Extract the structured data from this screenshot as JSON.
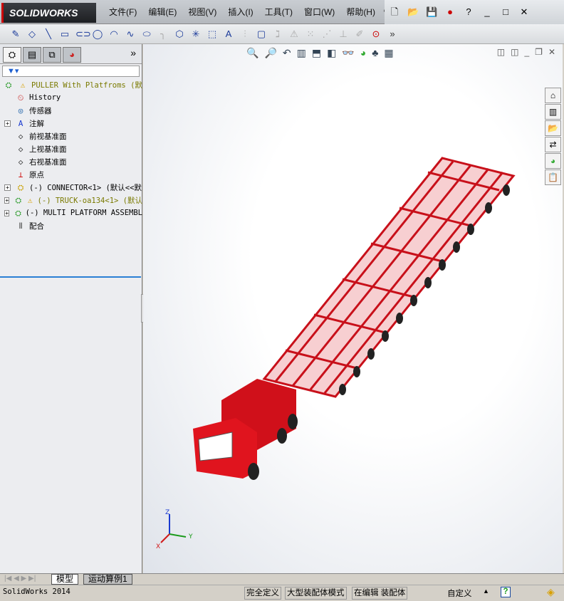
{
  "app": {
    "logo": "SOLIDWORKS"
  },
  "menu": [
    "文件(F)",
    "编辑(E)",
    "视图(V)",
    "插入(I)",
    "工具(T)",
    "窗口(W)",
    "帮助(H)"
  ],
  "panel": {
    "tree": [
      {
        "label": "PULLER With Platfroms  (默",
        "icon": "assembly",
        "warn": true,
        "olive": true,
        "expand": false,
        "top": true
      },
      {
        "label": "History",
        "icon": "history"
      },
      {
        "label": "传感器",
        "icon": "sensor"
      },
      {
        "label": "注解",
        "icon": "annotation",
        "expand": true
      },
      {
        "label": "前视基准面",
        "icon": "plane"
      },
      {
        "label": "上视基准面",
        "icon": "plane"
      },
      {
        "label": "右视基准面",
        "icon": "plane"
      },
      {
        "label": "原点",
        "icon": "origin"
      },
      {
        "label": "(-) CONNECTOR<1> (默认<<默",
        "icon": "part",
        "expand": true
      },
      {
        "label": "(-) TRUCK-oa134<1> (默认",
        "icon": "assembly",
        "expand": true,
        "warn": true,
        "olive": true
      },
      {
        "label": "(-) MULTI PLATFORM ASSEMBL",
        "icon": "assembly",
        "expand": true
      },
      {
        "label": "配合",
        "icon": "mates"
      }
    ]
  },
  "bottom_tabs": {
    "model": "模型",
    "motion": "运动算例1"
  },
  "status": {
    "app": "SolidWorks 2014",
    "defined": "完全定义",
    "mode": "大型装配体模式",
    "editing": "在编辑 装配体",
    "units": "自定义"
  },
  "axes": {
    "x": "X",
    "y": "Y",
    "z": "Z"
  },
  "colors": {
    "model": "#d0101a"
  }
}
